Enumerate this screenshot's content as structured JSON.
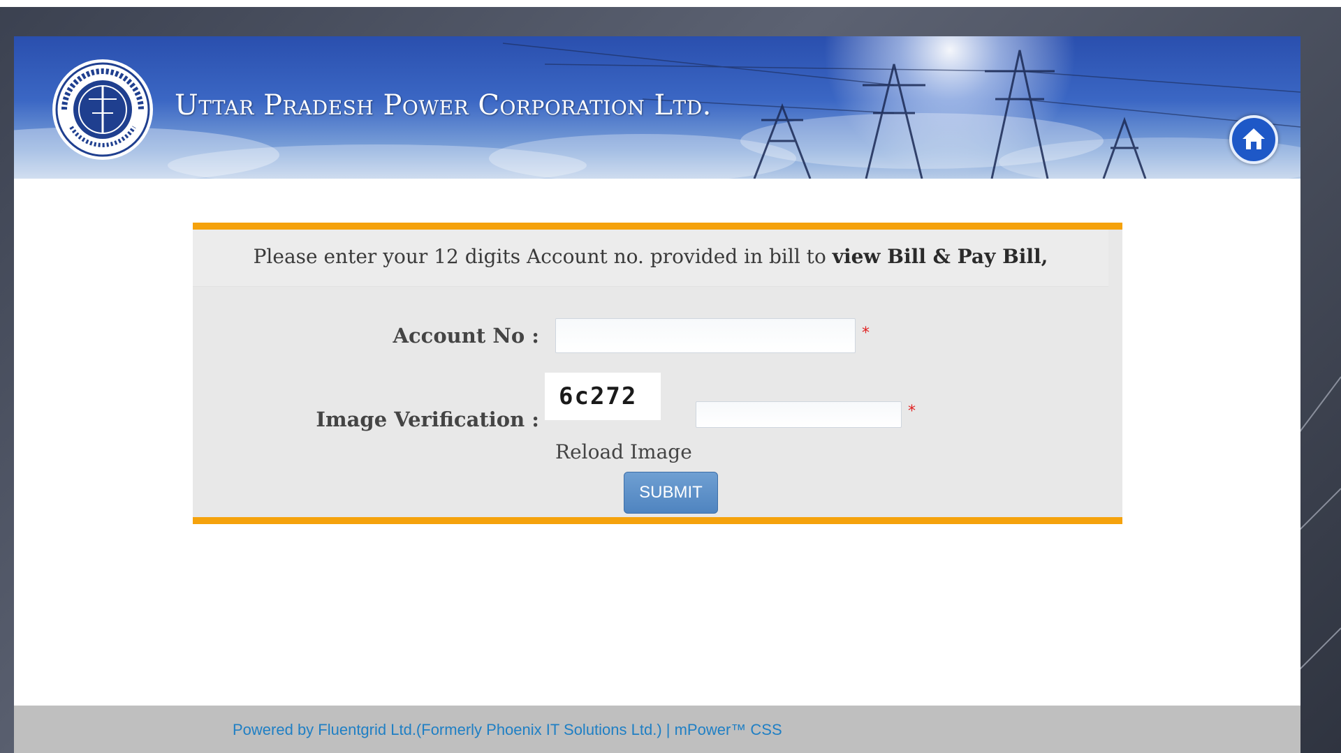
{
  "header": {
    "org_title": "Uttar Pradesh Power Corporation Ltd.",
    "logo_icon": "uppcl-seal-logo",
    "home_icon": "home-icon",
    "brand_color": "#2a4fae"
  },
  "form": {
    "intro_text": "Please enter your 12 digits Account no. provided in bill to ",
    "intro_bold": "view Bill & Pay Bill,",
    "account_label": "Account No :",
    "account_value": "",
    "image_label": "Image Verification :",
    "captcha_text": "6c272",
    "captcha_value": "",
    "required_mark": "*",
    "reload_label": "Reload Image",
    "submit_label": "SUBMIT",
    "accent_color": "#f5a20c"
  },
  "footer": {
    "powered_by": "Powered by Fluentgrid Ltd.(Formerly Phoenix IT Solutions Ltd.) | mPower™ CSS"
  }
}
